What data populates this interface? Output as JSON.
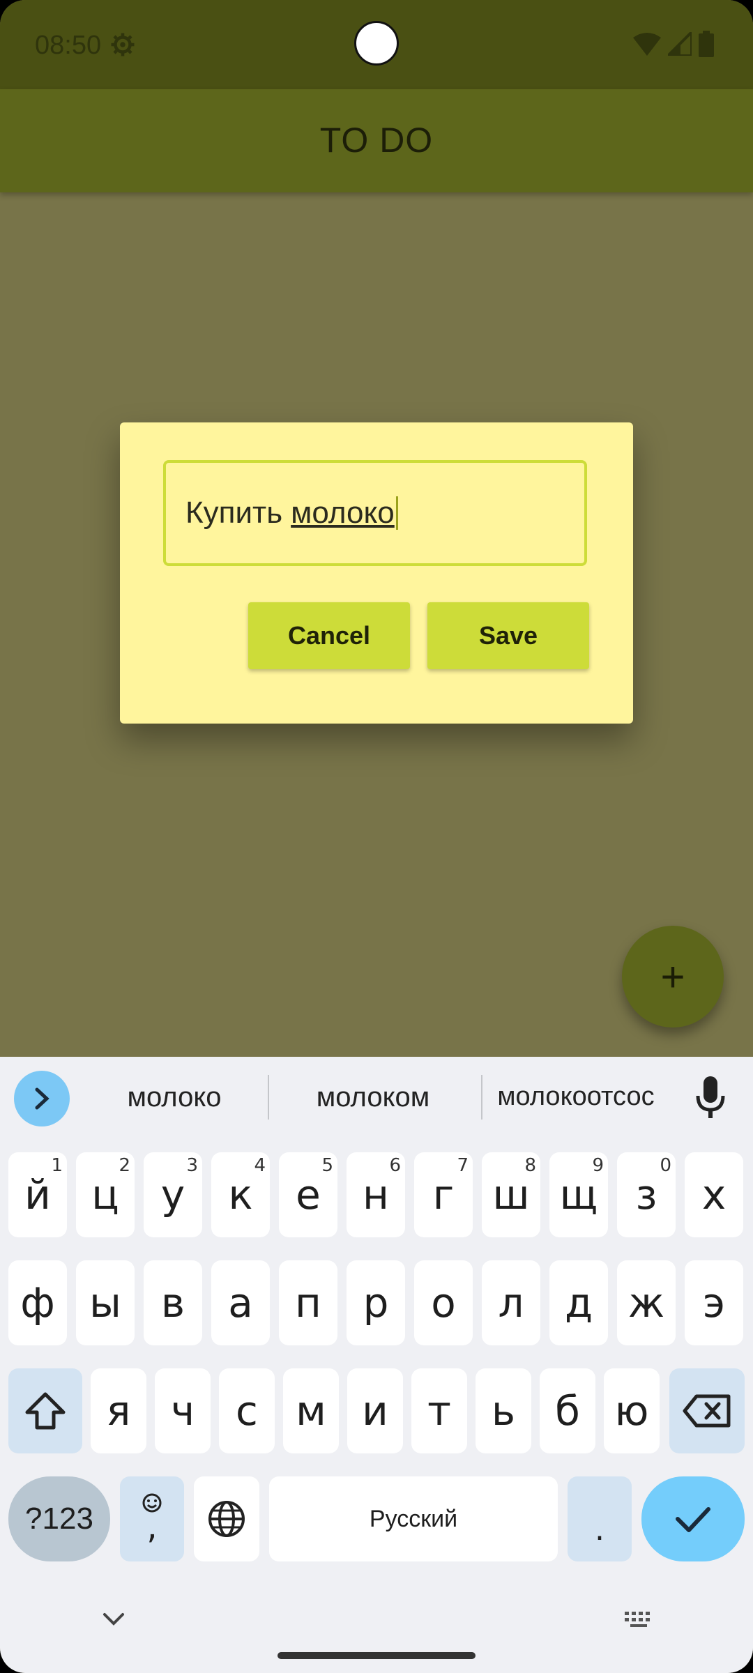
{
  "status_bar": {
    "time": "08:50"
  },
  "app_bar": {
    "title": "TO DO"
  },
  "dialog": {
    "input_value_prefix": "Купить",
    "input_value_underlined": "молоко",
    "cancel_label": "Cancel",
    "save_label": "Save"
  },
  "fab": {
    "label": "+"
  },
  "keyboard": {
    "suggestions": [
      "молоко",
      "молоком",
      "молокоотсос"
    ],
    "row1": [
      {
        "ch": "й",
        "hint": "1"
      },
      {
        "ch": "ц",
        "hint": "2"
      },
      {
        "ch": "у",
        "hint": "3"
      },
      {
        "ch": "к",
        "hint": "4"
      },
      {
        "ch": "е",
        "hint": "5"
      },
      {
        "ch": "н",
        "hint": "6"
      },
      {
        "ch": "г",
        "hint": "7"
      },
      {
        "ch": "ш",
        "hint": "8"
      },
      {
        "ch": "щ",
        "hint": "9"
      },
      {
        "ch": "з",
        "hint": "0"
      },
      {
        "ch": "х",
        "hint": ""
      }
    ],
    "row2": [
      "ф",
      "ы",
      "в",
      "а",
      "п",
      "р",
      "о",
      "л",
      "д",
      "ж",
      "э"
    ],
    "row3": [
      "я",
      "ч",
      "с",
      "м",
      "и",
      "т",
      "ь",
      "б",
      "ю"
    ],
    "symbols_label": "?123",
    "emoji_comma_label": ",",
    "space_label": "Русский",
    "period_label": "."
  },
  "colors": {
    "status_bar": "#4a5013",
    "app_bar": "#5d661b",
    "scrim": "#787449",
    "dialog": "#fff59d",
    "accent": "#cddc39",
    "keyboard_enter": "#74cdfb"
  }
}
